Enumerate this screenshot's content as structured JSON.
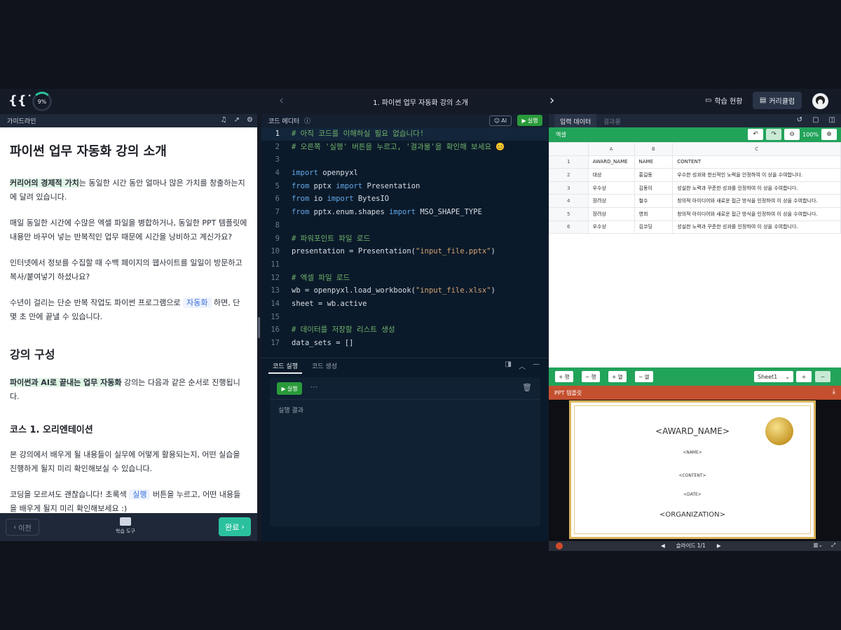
{
  "topbar": {
    "progress": "9%",
    "lesson_title": "1. 파이썬 업무 자동화 강의 소개",
    "status_label": "학습 현황",
    "curriculum_label": "커리큘럼"
  },
  "guide": {
    "header": "가이드라인",
    "title": "파이썬 업무 자동화 강의 소개",
    "p1_hl": "커리어의 경제적 가치",
    "p1_rest": "는 동일한 시간 동안 얼마나 많은 가치를 창출하는지에 달려 있습니다.",
    "p2": "매일 동일한 시간에 수많은 엑셀 파일을 병합하거나, 동일한 PPT 템플릿에 내용만 바꾸어 넣는 반복적인 업무 때문에 시간을 낭비하고 계신가요?",
    "p3": "인터넷에서 정보를 수집할 때 수백 페이지의 웹사이트를 일일이 방문하고 복사/붙여넣기 하셨나요?",
    "p4_a": "수년이 걸리는 단순 반복 작업도 파이썬 프로그램으로 ",
    "p4_chip": "자동화",
    "p4_b": " 하면, 단 몇 초 만에 끝낼 수 있습니다.",
    "h2": "강의 구성",
    "p5_hl": "파이썬과 AI로 끝내는 업무 자동화",
    "p5_rest": " 강의는 다음과 같은 순서로 진행됩니다.",
    "h3": "코스 1. 오리엔테이션",
    "p6": "본 강의에서 배우게 될 내용들이 실무에 어떻게 활용되는지, 어떤 실습을 진행하게 될지 미리 확인해보실 수 있습니다.",
    "p7_a": "코딩을 모르셔도 괜찮습니다! 초록색 ",
    "p7_chip": "실행",
    "p7_b": " 버튼을 누르고, 어떤 내용들을 배우게 될지 미리 확인해보세요 :)",
    "prev_label": "이전",
    "tools_label": "학습 도구",
    "done_label": "완료"
  },
  "editor": {
    "header": "코드 에디터",
    "ai_label": "AI",
    "run_label": "실행",
    "lines": [
      {
        "n": "1",
        "t": "# 아직 코드를 이해하실 필요 없습니다!",
        "c": "cm"
      },
      {
        "n": "2",
        "t": "# 오른쪽 '실행' 버튼을 누르고, '결과물'을 확인해 보세요 😊",
        "c": "cm"
      },
      {
        "n": "3",
        "t": "",
        "c": ""
      },
      {
        "n": "4",
        "t": "import openpyxl",
        "c": "imp"
      },
      {
        "n": "5",
        "t": "from pptx import Presentation",
        "c": "from"
      },
      {
        "n": "6",
        "t": "from io import BytesIO",
        "c": "from"
      },
      {
        "n": "7",
        "t": "from pptx.enum.shapes import MSO_SHAPE_TYPE",
        "c": "from"
      },
      {
        "n": "8",
        "t": "",
        "c": ""
      },
      {
        "n": "9",
        "t": "# 파워포인트 파일 로드",
        "c": "cm"
      },
      {
        "n": "10",
        "t": "presentation = Presentation(\"input_file.pptx\")",
        "c": "str"
      },
      {
        "n": "11",
        "t": "",
        "c": ""
      },
      {
        "n": "12",
        "t": "# 엑셀 파일 로드",
        "c": "cm"
      },
      {
        "n": "13",
        "t": "wb = openpyxl.load_workbook(\"input_file.xlsx\")",
        "c": "str"
      },
      {
        "n": "14",
        "t": "sheet = wb.active",
        "c": ""
      },
      {
        "n": "15",
        "t": "",
        "c": ""
      },
      {
        "n": "16",
        "t": "# 데이터를 저장할 리스트 생성",
        "c": "cm"
      },
      {
        "n": "17",
        "t": "data_sets = []",
        "c": ""
      }
    ],
    "tab_run": "코드 실행",
    "tab_gen": "코드 생성",
    "exec_run_label": "실행",
    "result_label": "실행 결과"
  },
  "right": {
    "tab_input": "입력 데이터",
    "tab_result": "결과물",
    "excel_label": "엑셀",
    "zoom": "100%",
    "columns": [
      "",
      "A",
      "B",
      "C"
    ],
    "rows": [
      {
        "num": "1",
        "a": "AWARD_NAME",
        "b": "NAME",
        "c": "CONTENT"
      },
      {
        "num": "2",
        "a": "대상",
        "b": "홍길동",
        "c": "우수한 성과와 헌신적인 노력을 인정하여 이 상을 수여합니다."
      },
      {
        "num": "3",
        "a": "우수상",
        "b": "김동이",
        "c": "성실한 노력과 꾸준한 성과를 인정하여 이 상을 수여합니다."
      },
      {
        "num": "4",
        "a": "장려상",
        "b": "철수",
        "c": "창의적 아이디어와 새로운 접근 방식을 인정하여 이 상을 수여합니다."
      },
      {
        "num": "5",
        "a": "장려상",
        "b": "영희",
        "c": "창의적 아이디어와 새로운 접근 방식을 인정하여 이 상을 수여합니다."
      },
      {
        "num": "6",
        "a": "우수상",
        "b": "김코딩",
        "c": "성실한 노력과 꾸준한 성과를 인정하여 이 상을 수여합니다."
      }
    ],
    "add_row": "+ 행",
    "del_row": "− 행",
    "add_col": "+ 열",
    "del_col": "− 열",
    "sheet_name": "Sheet1",
    "ppt_label": "PPT 템플릿",
    "cert_award": "<AWARD_NAME>",
    "cert_name": "<NAME>",
    "cert_content": "<CONTENT>",
    "cert_date": "<DATE>",
    "cert_org": "<ORGANIZATION>",
    "slide_label": "슬라이드 1/1"
  }
}
